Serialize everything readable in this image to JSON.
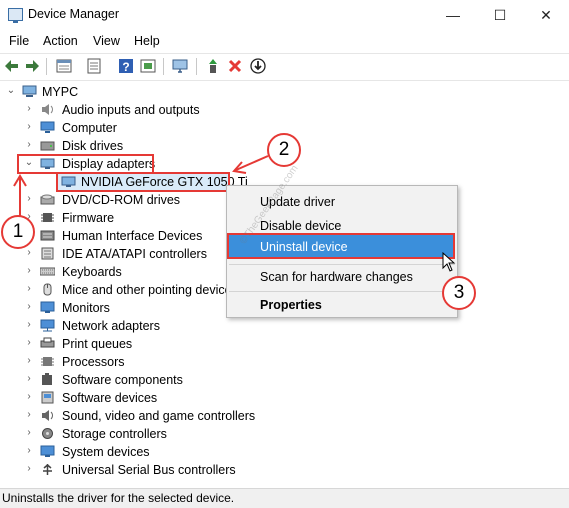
{
  "window": {
    "title": "Device Manager",
    "minimize": "—",
    "maximize": "☐",
    "close": "✕"
  },
  "menu": [
    "File",
    "Action",
    "View",
    "Help"
  ],
  "toolbar": {
    "icons": [
      "back-arrow-icon",
      "forward-arrow-icon",
      "properties-icon",
      "help-list-icon",
      "help-icon",
      "action-icon",
      "monitor-icon",
      "scan-hardware-icon",
      "uninstall-x-icon",
      "download-driver-icon"
    ],
    "accent_red": "#e53935",
    "accent_green": "#2e9a3e"
  },
  "tree": {
    "root": "MYPC",
    "nodes": [
      {
        "label": "Audio inputs and outputs",
        "icon": "speaker-icon"
      },
      {
        "label": "Computer",
        "icon": "computer-icon"
      },
      {
        "label": "Disk drives",
        "icon": "disk-icon"
      },
      {
        "label": "Display adapters",
        "icon": "display-adapter-icon",
        "expanded": true
      },
      {
        "label": "NVIDIA GeForce GTX 1050 Ti",
        "icon": "gpu-icon",
        "child": true
      },
      {
        "label": "DVD/CD-ROM drives",
        "icon": "dvd-icon"
      },
      {
        "label": "Firmware",
        "icon": "firmware-icon"
      },
      {
        "label": "Human Interface Devices",
        "icon": "hid-icon"
      },
      {
        "label": "IDE ATA/ATAPI controllers",
        "icon": "ide-icon"
      },
      {
        "label": "Keyboards",
        "icon": "keyboard-icon"
      },
      {
        "label": "Mice and other pointing device",
        "icon": "mouse-icon"
      },
      {
        "label": "Monitors",
        "icon": "monitor-icon"
      },
      {
        "label": "Network adapters",
        "icon": "network-icon"
      },
      {
        "label": "Print queues",
        "icon": "printer-icon"
      },
      {
        "label": "Processors",
        "icon": "processor-icon"
      },
      {
        "label": "Software components",
        "icon": "puzzle-icon"
      },
      {
        "label": "Software devices",
        "icon": "software-device-icon"
      },
      {
        "label": "Sound, video and game controllers",
        "icon": "sound-icon"
      },
      {
        "label": "Storage controllers",
        "icon": "storage-icon"
      },
      {
        "label": "System devices",
        "icon": "system-icon"
      },
      {
        "label": "Universal Serial Bus controllers",
        "icon": "usb-icon"
      }
    ]
  },
  "context_menu": {
    "items": [
      "Update driver",
      "Disable device",
      "Uninstall device",
      "Scan for hardware changes",
      "Properties"
    ],
    "active_item": "Uninstall device",
    "highlight_color": "#3b8fdb"
  },
  "callouts": [
    "1",
    "2",
    "3"
  ],
  "watermark": "©TheGeekPage.com",
  "status_text": "Uninstalls the driver for the selected device."
}
